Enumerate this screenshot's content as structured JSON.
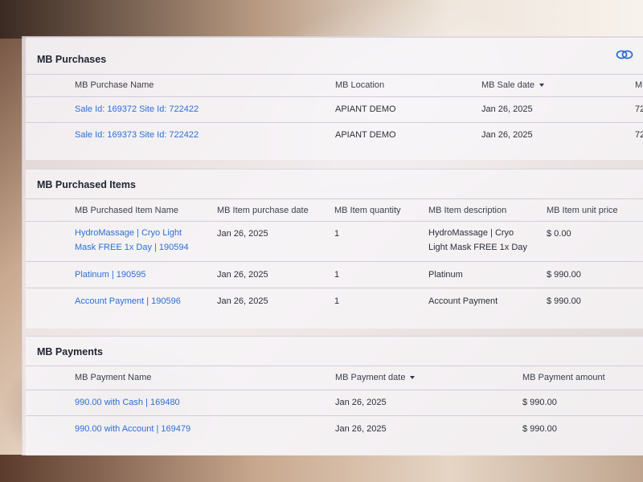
{
  "purchases": {
    "title": "MB Purchases",
    "columns": [
      "MB Purchase Name",
      "MB Location",
      "MB Sale date",
      "M"
    ],
    "rows": [
      {
        "name": "Sale Id: 169372 Site Id: 722422",
        "location": "APIANT DEMO",
        "date": "Jan 26, 2025",
        "extra": "72"
      },
      {
        "name": "Sale Id: 169373 Site Id: 722422",
        "location": "APIANT DEMO",
        "date": "Jan 26, 2025",
        "extra": "72"
      }
    ]
  },
  "items": {
    "title": "MB Purchased Items",
    "columns": [
      "MB Purchased Item Name",
      "MB Item purchase date",
      "MB Item quantity",
      "MB Item description",
      "MB Item unit price"
    ],
    "rows": [
      {
        "name": "HydroMassage | Cryo Light Mask FREE 1x Day | 190594",
        "date": "Jan 26, 2025",
        "qty": "1",
        "desc": "HydroMassage | Cryo Light Mask FREE 1x Day",
        "price": "$ 0.00"
      },
      {
        "name": "Platinum | 190595",
        "date": "Jan 26, 2025",
        "qty": "1",
        "desc": "Platinum",
        "price": "$ 990.00"
      },
      {
        "name": "Account Payment | 190596",
        "date": "Jan 26, 2025",
        "qty": "1",
        "desc": "Account Payment",
        "price": "$ 990.00"
      }
    ]
  },
  "payments": {
    "title": "MB Payments",
    "columns": [
      "MB Payment Name",
      "MB Payment date",
      "MB Payment amount"
    ],
    "rows": [
      {
        "name": "990.00 with Cash | 169480",
        "date": "Jan 26, 2025",
        "amount": "$ 990.00"
      },
      {
        "name": "990.00 with Account | 169479",
        "date": "Jan 26, 2025",
        "amount": "$ 990.00"
      }
    ]
  },
  "icons": {
    "link": "link-chain-icon",
    "sort": "sort-desc-icon"
  },
  "colors": {
    "link": "#2a6fd6",
    "icon": "#2a6fd6"
  }
}
